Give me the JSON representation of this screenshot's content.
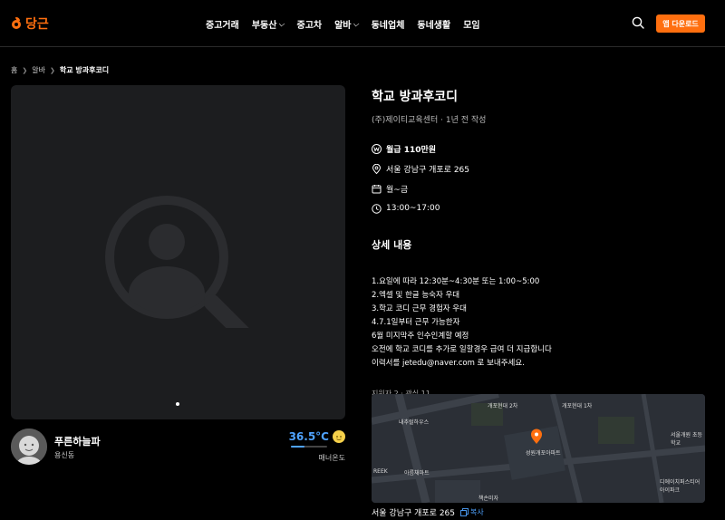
{
  "header": {
    "logo_text": "당근",
    "nav": [
      {
        "label": "중고거래",
        "dropdown": false
      },
      {
        "label": "부동산",
        "dropdown": true
      },
      {
        "label": "중고차",
        "dropdown": false
      },
      {
        "label": "알바",
        "dropdown": true
      },
      {
        "label": "동네업체",
        "dropdown": false
      },
      {
        "label": "동네생활",
        "dropdown": false
      },
      {
        "label": "모임",
        "dropdown": false
      }
    ],
    "app_download": "앱 다운로드"
  },
  "breadcrumb": {
    "home": "홈",
    "category": "알바",
    "current": "학교 방과후코디"
  },
  "profile": {
    "name": "푸른하늘파",
    "location": "용신동",
    "temperature": "36.5°C",
    "temperature_level": 36.5,
    "manner_label": "매너온도"
  },
  "job": {
    "title": "학교 방과후코디",
    "meta": "(주)제이티교육센터 · 1년 전 작성",
    "wage": "월급 110만원",
    "address": "서울 강남구 개포로 265",
    "days": "월~금",
    "hours": "13:00~17:00",
    "detail_title": "상세 내용",
    "description": [
      "1.요일에 따라 12:30분~4:30분 또는 1:00~5:00",
      "2.엑셀 및 한글 능숙자 우대",
      "3.학교 코디 근무 경험자 우대",
      "4.7.1일부터 근무 가능한자",
      "6월 미지막주 인수인계할 예정",
      "오전에 학교 코디를 추가로 일할경우 급여 더 지급합니다",
      "이력서를 jetedu@naver.com 로 보내주세요."
    ],
    "stats": "지원자 2 · 관심 11"
  },
  "map": {
    "labels": [
      "개포현대 2차",
      "개포현대 1차",
      "내추럴하우스",
      "서울개원 초등학교",
      "성원개포아파트",
      "아름채마트",
      "디에이치퍼스티어 아이파크",
      "책손미자",
      "REEK"
    ],
    "marker_color": "#ff6f0f"
  },
  "address_bar": {
    "address": "서울 강남구 개포로 265",
    "copy_label": "복사"
  },
  "colors": {
    "accent": "#ff6f0f",
    "temperature": "#4fa3ff"
  }
}
